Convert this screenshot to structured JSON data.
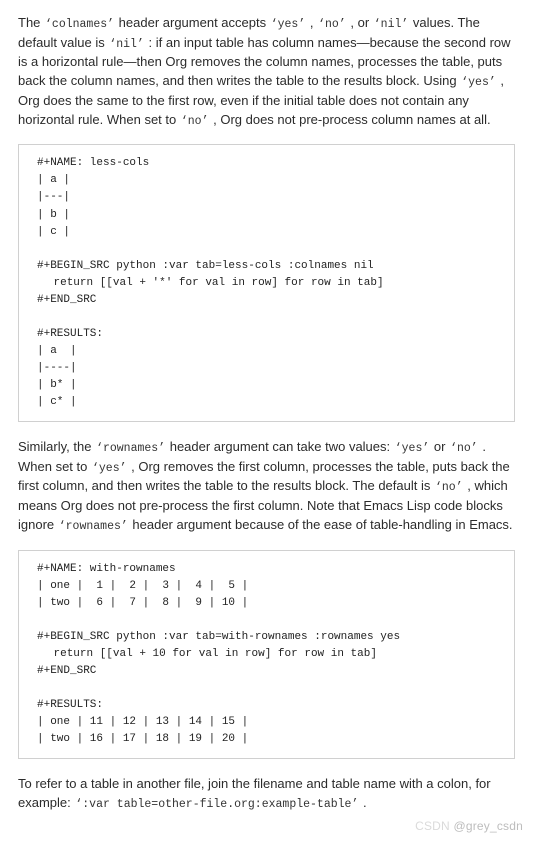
{
  "para1": {
    "seg0": "The ",
    "code_colnames": "colnames",
    "seg1": "  header argument accepts ",
    "code_yes1": "yes",
    "seg_comma1": " , ",
    "code_no1": "no",
    "seg_or1": " , or ",
    "code_nil1": "nil",
    "seg2": "  values. The default value is ",
    "code_nil2": "nil",
    "seg3": "  : if an input table has column names—because the second row is a horizontal rule—then Org removes the column names, processes the table, puts back the column names, and then writes the table to the results block. Using ",
    "code_yes2": "yes",
    "seg4": " , Org does the same to the first row, even if the initial table does not contain any horizontal rule. When set to ",
    "code_no2": "no",
    "seg5": " , Org does not pre-process column names at all."
  },
  "codeblock1": {
    "l1": "#+NAME: less-cols",
    "l2": "| a |",
    "l3": "|---|",
    "l4": "| b |",
    "l5": "| c |",
    "l6": "#+BEGIN_SRC python :var tab=less-cols :colnames nil",
    "l7": "return [[val + '*' for val in row] for row in tab]",
    "l8": "#+END_SRC",
    "l9": "#+RESULTS:",
    "l10": "| a  |",
    "l11": "|----|",
    "l12": "| b* |",
    "l13": "| c* |"
  },
  "para2": {
    "seg0": "Similarly, the ",
    "code_rownames1": "rownames",
    "seg1": "  header argument can take two values: ",
    "code_yes": "yes",
    "seg_or": "  or ",
    "code_no1": "no",
    "seg2": " . When set to ",
    "code_yes2": "yes",
    "seg3": " , Org removes the first column, processes the table, puts back the first column, and then writes the table to the results block. The default is ",
    "code_no2": "no",
    "seg4": " , which means Org does not pre-process the first column. Note that Emacs Lisp code blocks ignore ",
    "code_rownames2": "rownames",
    "seg5": "  header argument because of the ease of table-handling in Emacs."
  },
  "codeblock2": {
    "l1": "#+NAME: with-rownames",
    "l2": "| one |  1 |  2 |  3 |  4 |  5 |",
    "l3": "| two |  6 |  7 |  8 |  9 | 10 |",
    "l4": "#+BEGIN_SRC python :var tab=with-rownames :rownames yes",
    "l5": "return [[val + 10 for val in row] for row in tab]",
    "l6": "#+END_SRC",
    "l7": "#+RESULTS:",
    "l8": "| one | 11 | 12 | 13 | 14 | 15 |",
    "l9": "| two | 16 | 17 | 18 | 19 | 20 |"
  },
  "para3": {
    "seg0": "To refer to a table in another file, join the filename and table name with a colon, for example:  ",
    "code_var": ":var table=other-file.org:example-table",
    "seg1": " ."
  },
  "watermark": {
    "left": "CSDN",
    "right": " @grey_csdn"
  }
}
